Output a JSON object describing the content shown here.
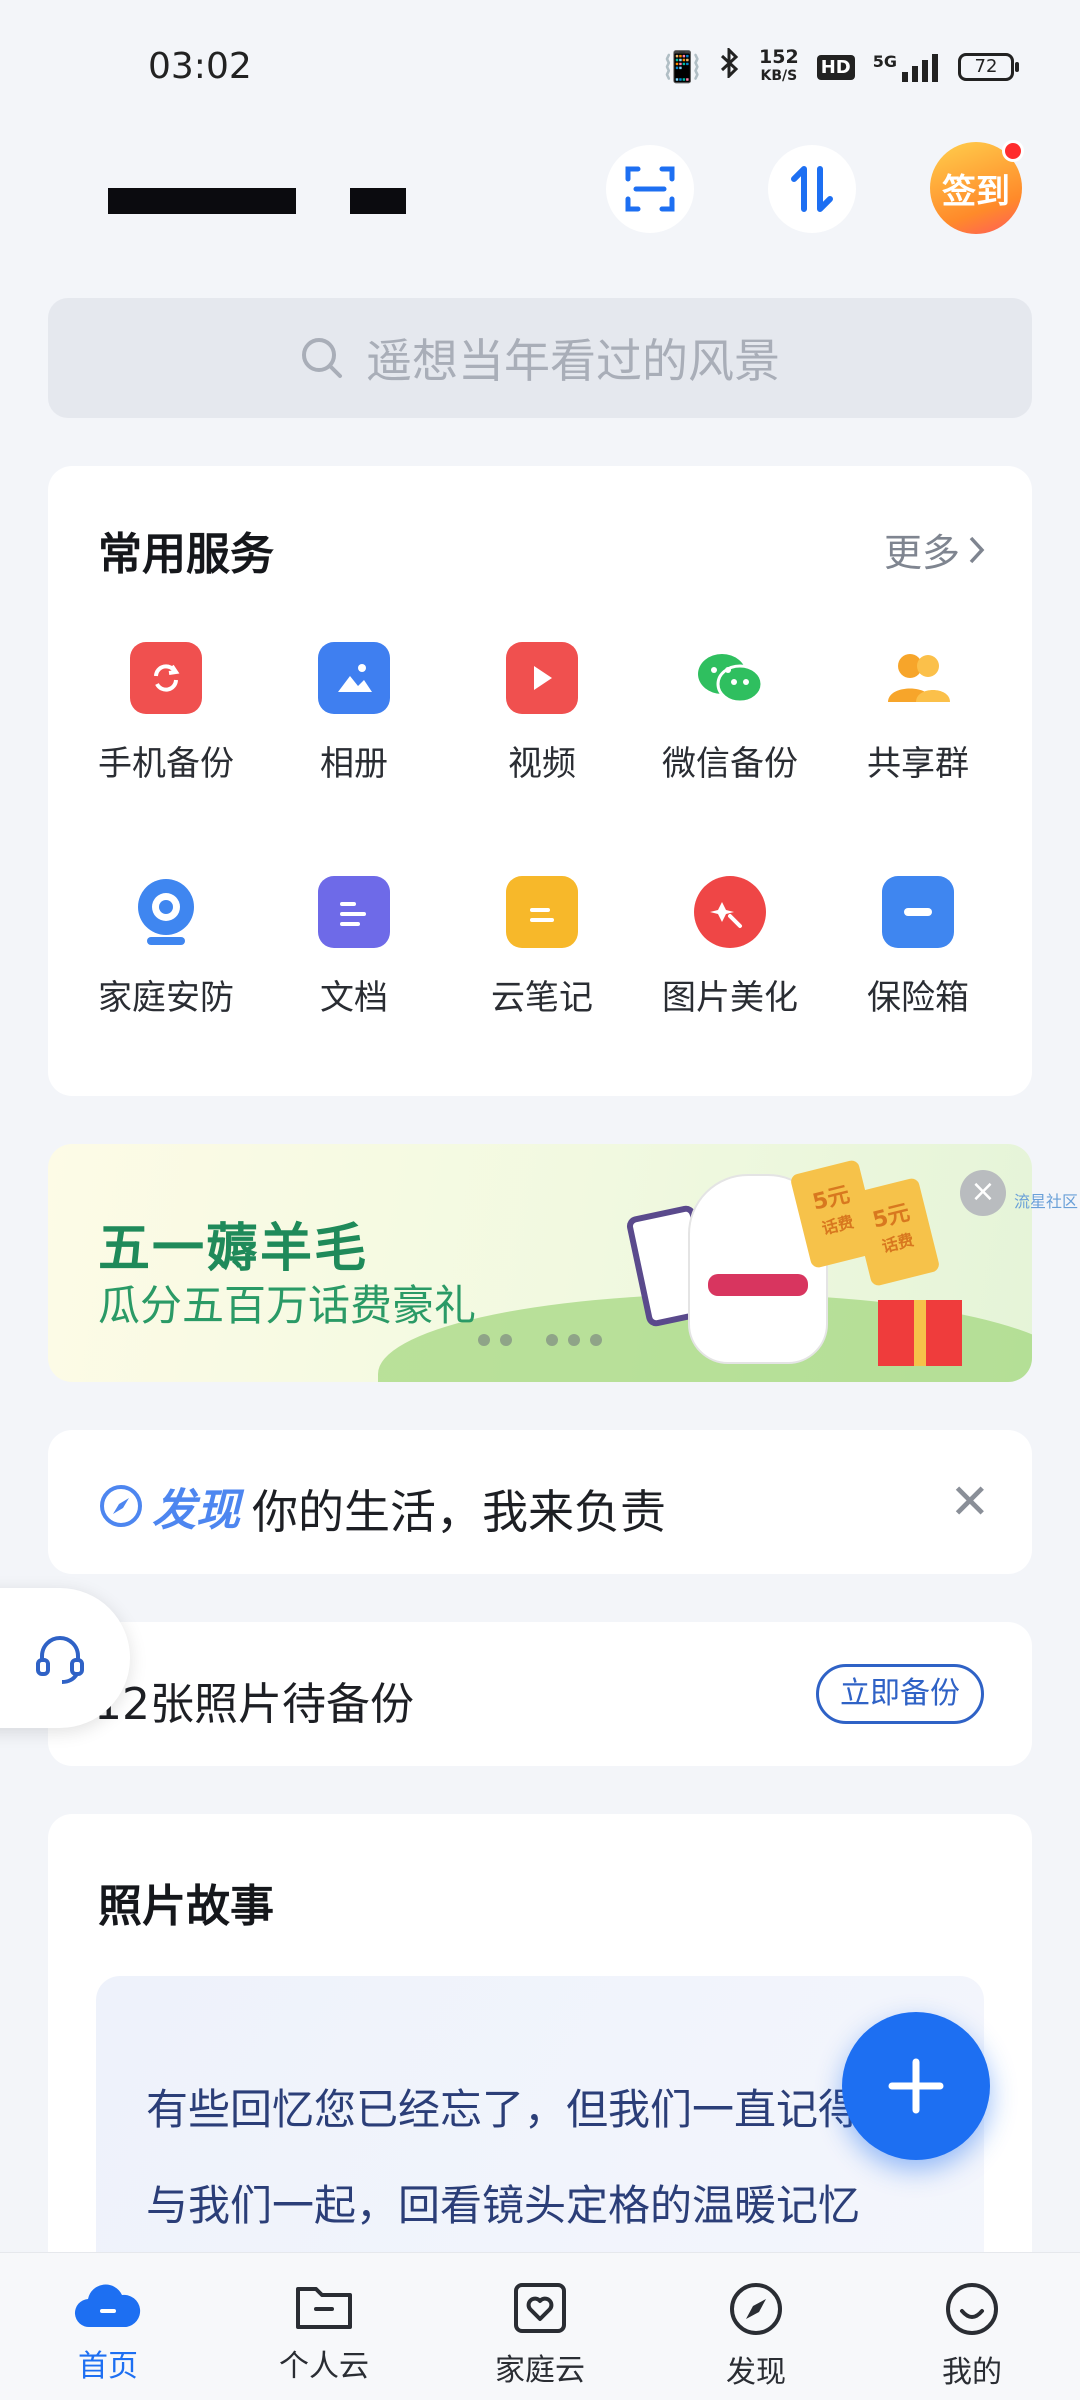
{
  "status_bar": {
    "time": "03:02",
    "net_speed_value": "152",
    "net_speed_unit": "KB/S",
    "hd": "HD",
    "network": "5G",
    "battery": "72"
  },
  "header": {
    "signin_label": "签到"
  },
  "search": {
    "placeholder": "遥想当年看过的风景"
  },
  "services": {
    "title": "常用服务",
    "more_label": "更多",
    "items": [
      {
        "label": "手机备份",
        "icon": "phone-backup-icon",
        "color": "#f0504f"
      },
      {
        "label": "相册",
        "icon": "album-icon",
        "color": "#3f7ff0"
      },
      {
        "label": "视频",
        "icon": "video-icon",
        "color": "#f0504f"
      },
      {
        "label": "微信备份",
        "icon": "wechat-backup-icon",
        "color": "#2fbf5f"
      },
      {
        "label": "共享群",
        "icon": "share-group-icon",
        "color": "#f7a52a"
      },
      {
        "label": "家庭安防",
        "icon": "home-camera-icon",
        "color": "#3f86f0"
      },
      {
        "label": "文档",
        "icon": "document-icon",
        "color": "#6e6ae8"
      },
      {
        "label": "云笔记",
        "icon": "cloud-note-icon",
        "color": "#f7b82a"
      },
      {
        "label": "图片美化",
        "icon": "photo-beautify-icon",
        "color": "#ef4646"
      },
      {
        "label": "保险箱",
        "icon": "safe-box-icon",
        "color": "#3f86f0"
      }
    ]
  },
  "banner": {
    "title": "五一薅羊毛",
    "subtitle": "瓜分五百万话费豪礼",
    "side_link": "流星社区",
    "ticket_label": "5元",
    "ticket_sub": "话费"
  },
  "discover": {
    "tag": "发现",
    "text": "你的生活，我来负责"
  },
  "backup": {
    "text": "12张照片待备份",
    "button": "立即备份"
  },
  "story": {
    "title": "照片故事",
    "line1": "有些回忆您已经忘了，但我们一直记得",
    "line2": "与我们一起，回看镜头定格的温暖记忆"
  },
  "bottom_nav": [
    {
      "label": "首页",
      "icon": "home-cloud-icon",
      "active": true
    },
    {
      "label": "个人云",
      "icon": "folder-icon",
      "active": false
    },
    {
      "label": "家庭云",
      "icon": "family-heart-icon",
      "active": false
    },
    {
      "label": "发现",
      "icon": "compass-icon",
      "active": false
    },
    {
      "label": "我的",
      "icon": "smile-icon",
      "active": false
    }
  ],
  "colors": {
    "accent": "#1d6ff2",
    "banner_green": "#1f8a5a",
    "badge_red": "#ff2d2d"
  }
}
